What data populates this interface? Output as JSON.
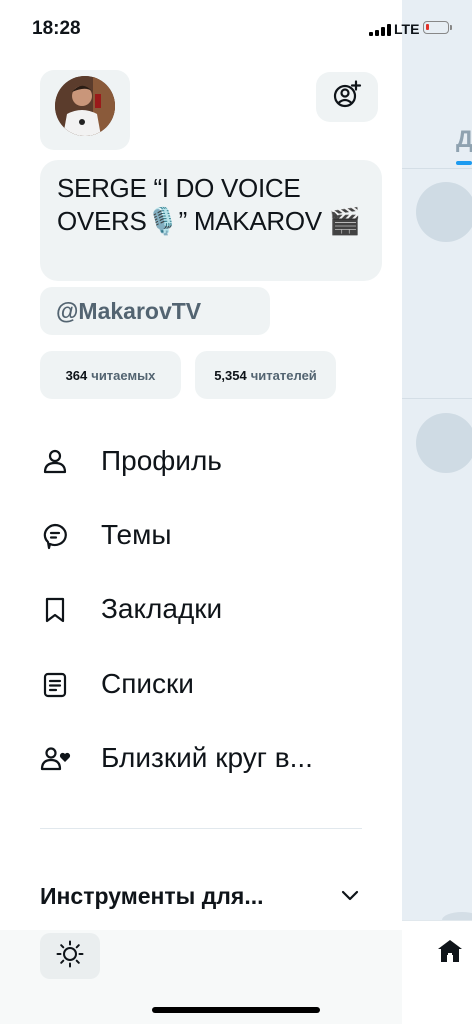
{
  "status_bar": {
    "time": "18:28",
    "network": "LTE"
  },
  "profile": {
    "display_name": "SERGE “I DO VOICE OVERS🎙️” MAKAROV 🎬",
    "handle": "@MakarovTV",
    "following_count": "364",
    "following_label": "читаемых",
    "followers_count": "5,354",
    "followers_label": "читателей"
  },
  "menu": [
    {
      "label": "Профиль",
      "icon": "person-icon"
    },
    {
      "label": "Темы",
      "icon": "topics-icon"
    },
    {
      "label": "Закладки",
      "icon": "bookmark-icon"
    },
    {
      "label": "Списки",
      "icon": "list-icon"
    },
    {
      "label": "Близкий круг в...",
      "icon": "circle-icon"
    }
  ],
  "sections": {
    "tools_label": "Инструменты для..."
  },
  "background": {
    "tab_fragment": "Д"
  },
  "colors": {
    "accent": "#1d9bf0",
    "text": "#0f1419",
    "secondary": "#536471",
    "chip_bg": "#eff3f4"
  }
}
